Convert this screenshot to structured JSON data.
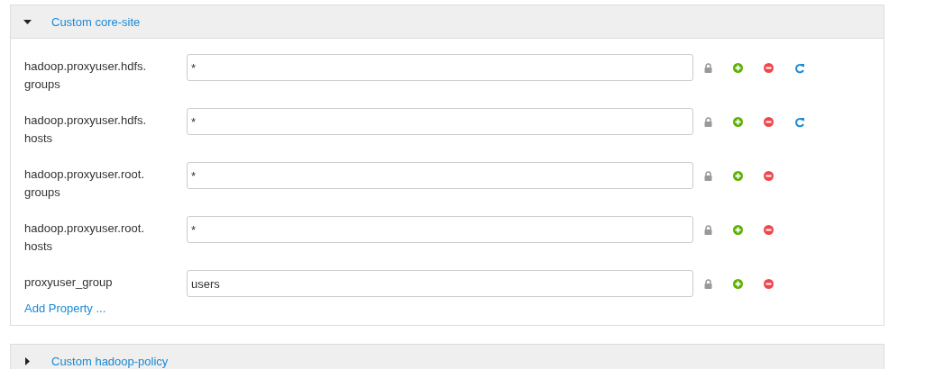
{
  "panels": [
    {
      "title": "Custom core-site",
      "expanded": true,
      "properties": [
        {
          "name": "hadoop.proxyuser.hdfs.groups",
          "value": "*",
          "revertible": true
        },
        {
          "name": "hadoop.proxyuser.hdfs.hosts",
          "value": "*",
          "revertible": true
        },
        {
          "name": "hadoop.proxyuser.root.groups",
          "value": "*",
          "revertible": false
        },
        {
          "name": "hadoop.proxyuser.root.hosts",
          "value": "*",
          "revertible": false
        },
        {
          "name": "proxyuser_group",
          "value": "users",
          "revertible": false
        }
      ],
      "add_link": "Add Property ..."
    },
    {
      "title": "Custom hadoop-policy",
      "expanded": false
    }
  ]
}
